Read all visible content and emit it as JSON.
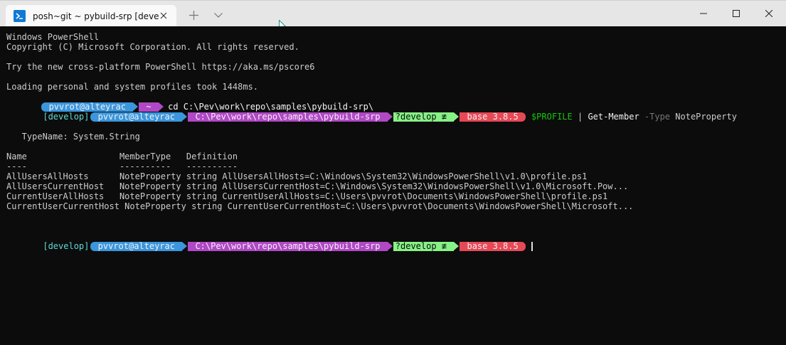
{
  "window": {
    "tab_title": "posh~git ~ pybuild-srp [develop]",
    "colors": {
      "titlebar": "#e6e6e6",
      "terminal_bg": "#0c0c0c",
      "terminal_fg": "#cccccc"
    }
  },
  "terminal": {
    "banner": [
      "Windows PowerShell",
      "Copyright (C) Microsoft Corporation. All rights reserved.",
      "",
      "Try the new cross-platform PowerShell https://aka.ms/pscore6",
      "",
      "Loading personal and system profiles took 1448ms."
    ],
    "prompt1": {
      "user": " pvvrot@alteyrac ",
      "dir": " ~ ",
      "command": " cd C:\\Pev\\work\\repo\\samples\\pybuild-srp\\"
    },
    "prompt2": {
      "branch": "[develop]",
      "user": " pvvrot@alteyrac ",
      "dir": " C:\\Pev\\work\\repo\\samples\\pybuild-srp ",
      "git": "?develop ≢ ",
      "env": " base 3.8.5 ",
      "cmd_var": "$PROFILE",
      "cmd_pipe": " | ",
      "cmd_name": "Get-Member",
      "cmd_param": " -Type",
      "cmd_arg": " NoteProperty"
    },
    "output": [
      "",
      "",
      "   TypeName: System.String",
      "",
      "Name                  MemberType   Definition",
      "----                  ----------   ----------",
      "AllUsersAllHosts      NoteProperty string AllUsersAllHosts=C:\\Windows\\System32\\WindowsPowerShell\\v1.0\\profile.ps1",
      "AllUsersCurrentHost   NoteProperty string AllUsersCurrentHost=C:\\Windows\\System32\\WindowsPowerShell\\v1.0\\Microsoft.Pow...",
      "CurrentUserAllHosts   NoteProperty string CurrentUserAllHosts=C:\\Users\\pvvrot\\Documents\\WindowsPowerShell\\profile.ps1",
      "CurrentUserCurrentHost NoteProperty string CurrentUserCurrentHost=C:\\Users\\pvvrot\\Documents\\WindowsPowerShell\\Microsoft..."
    ],
    "prompt3": {
      "branch": "[develop]",
      "user": " pvvrot@alteyrac ",
      "dir": " C:\\Pev\\work\\repo\\samples\\pybuild-srp ",
      "git": "?develop ≢ ",
      "env": " base 3.8.5 "
    }
  }
}
